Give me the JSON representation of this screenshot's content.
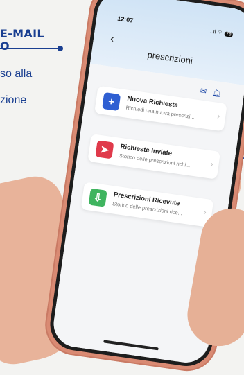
{
  "promo": {
    "title_line1": "E-MAIL",
    "title_line2": "O",
    "body_line1": "so alla",
    "body_line2": "zione"
  },
  "status_bar": {
    "time": "12:07",
    "signal": "..ıl ⌔",
    "battery": "78"
  },
  "header": {
    "back_label": "‹",
    "title": "prescrizioni"
  },
  "toolbar_icons": [
    "mail-icon",
    "bell-icon"
  ],
  "cards": [
    {
      "title": "Nuova Richiesta",
      "subtitle": "Richiedi una nuova prescrizi...",
      "icon": "plus-icon",
      "color": "#2f5fd2",
      "glyph": "+"
    },
    {
      "title": "Richieste Inviate",
      "subtitle": "Storico delle prescrizioni richi...",
      "icon": "send-icon",
      "color": "#e03a4b",
      "glyph": "➤"
    },
    {
      "title": "Prescrizioni Ricevute",
      "subtitle": "Storico delle prescrizioni rice...",
      "icon": "inbox-download-icon",
      "color": "#3fb45f",
      "glyph": "⇩"
    }
  ],
  "colors": {
    "brand": "#1a3f91",
    "phone_frame": "#d98a73"
  }
}
